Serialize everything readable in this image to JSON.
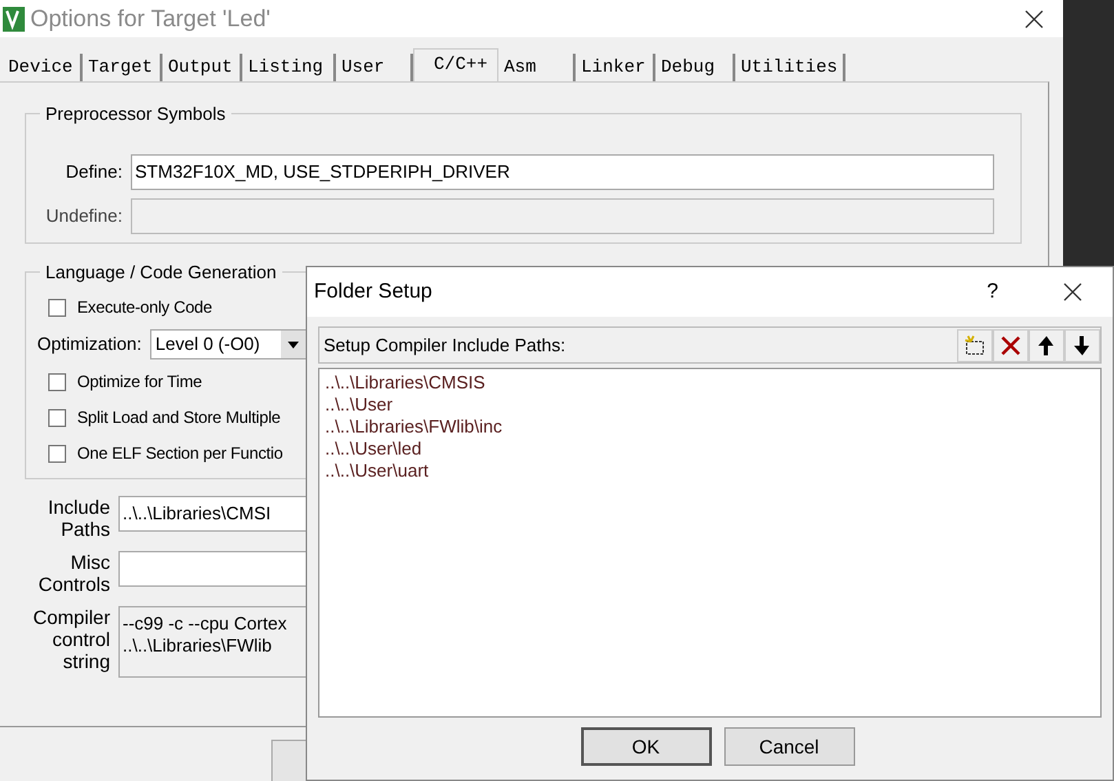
{
  "window": {
    "title": "Options for Target 'Led'"
  },
  "tabs": [
    {
      "label": "Device",
      "selected": false
    },
    {
      "label": "Target",
      "selected": false
    },
    {
      "label": "Output",
      "selected": false
    },
    {
      "label": "Listing",
      "selected": false
    },
    {
      "label": "User",
      "selected": false
    },
    {
      "label": "C/C++",
      "selected": true
    },
    {
      "label": "Asm",
      "selected": false
    },
    {
      "label": "Linker",
      "selected": false
    },
    {
      "label": "Debug",
      "selected": false
    },
    {
      "label": "Utilities",
      "selected": false
    }
  ],
  "preprocessor": {
    "title": "Preprocessor Symbols",
    "define_label": "Define:",
    "define_value": "STM32F10X_MD, USE_STDPERIPH_DRIVER",
    "undefine_label": "Undefine:"
  },
  "language": {
    "title": "Language / Code Generation",
    "optimization_label": "Optimization:",
    "optimization_value": "Level 0 (-O0)",
    "options": [
      {
        "kind": "checkbox",
        "label": "Execute-only Code",
        "checked": false
      },
      {
        "kind": "select"
      },
      {
        "kind": "checkbox",
        "label": "Optimize for Time",
        "checked": false
      },
      {
        "kind": "checkbox",
        "label": "Split Load and Store Multiple",
        "checked": false
      },
      {
        "kind": "checkbox",
        "label": "One ELF Section per Functio",
        "checked": false
      }
    ]
  },
  "include_paths": {
    "label_lines": [
      "Include",
      "Paths"
    ],
    "value": "..\\..\\Libraries\\CMSI"
  },
  "misc_controls": {
    "label_lines": [
      "Misc",
      "Controls"
    ]
  },
  "compiler_control_string": {
    "label_lines": [
      "Compiler",
      "control",
      "string"
    ],
    "lines": [
      "--c99 -c --cpu Cortex",
      "..\\..\\Libraries\\FWlib"
    ]
  },
  "folder_setup": {
    "title": "Folder Setup",
    "help": "?",
    "header": "Setup Compiler Include Paths:",
    "paths": [
      "..\\..\\Libraries\\CMSIS",
      "..\\..\\User",
      "..\\..\\Libraries\\FWlib\\inc",
      "..\\..\\User\\led",
      "..\\..\\User\\uart"
    ],
    "buttons": [
      "OK",
      "Cancel"
    ]
  }
}
